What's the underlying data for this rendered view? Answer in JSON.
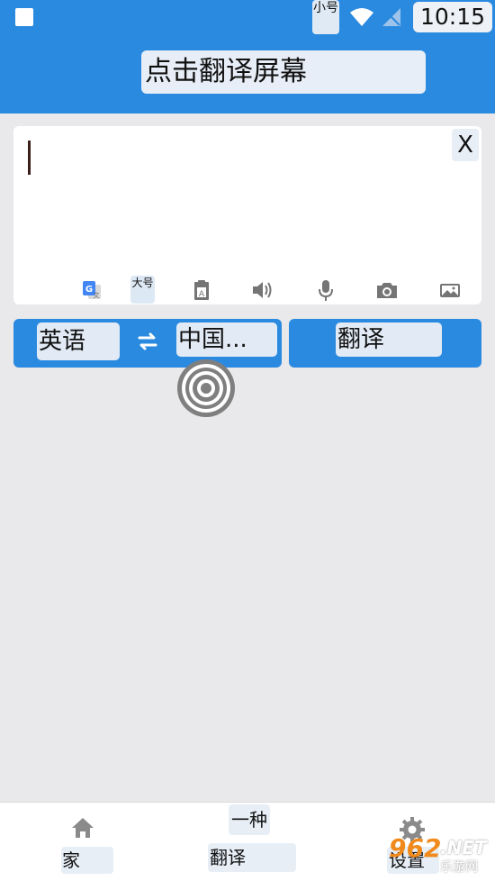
{
  "status_bar": {
    "small_size_label": "小号",
    "time": "10:15"
  },
  "header": {
    "title": "点击翻译屏幕"
  },
  "input": {
    "clear_label": "X",
    "font_size_label": "大号",
    "tools": [
      "translate-icon",
      "font-size-button",
      "clipboard-icon",
      "speaker-icon",
      "microphone-icon",
      "camera-icon",
      "image-icon"
    ]
  },
  "languages": {
    "source": "英语",
    "target": "中国...",
    "translate_label": "翻译"
  },
  "bottom_nav": {
    "home_label": "家",
    "type_label": "一种",
    "translate_label": "翻译",
    "settings_label": "设置"
  },
  "watermark": {
    "digits": "962",
    "suffix": ".NET",
    "sub": "乐游网"
  },
  "colors": {
    "primary": "#2a8ae0",
    "background": "#e9e8ea",
    "chip": "#e2ebf5"
  }
}
